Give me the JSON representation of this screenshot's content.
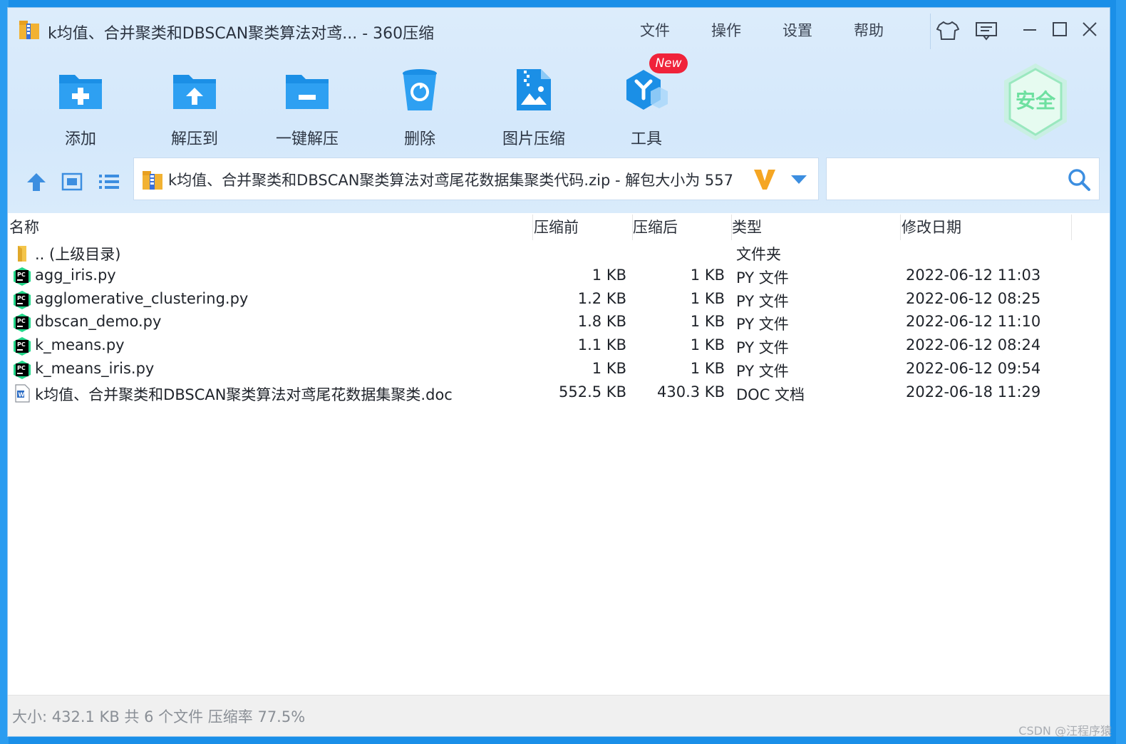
{
  "window": {
    "title": "k均值、合并聚类和DBSCAN聚类算法对鸢... - 360压缩"
  },
  "menu": [
    {
      "label": "文件"
    },
    {
      "label": "操作"
    },
    {
      "label": "设置"
    },
    {
      "label": "帮助"
    }
  ],
  "toolbar": {
    "tools": [
      {
        "label": "添加",
        "icon": "add-folder-icon"
      },
      {
        "label": "解压到",
        "icon": "extract-to-icon"
      },
      {
        "label": "一键解压",
        "icon": "one-click-extract-icon"
      },
      {
        "label": "删除",
        "icon": "recycle-bin-icon"
      },
      {
        "label": "图片压缩",
        "icon": "image-compress-icon"
      },
      {
        "label": "工具",
        "icon": "tools-icon"
      }
    ],
    "new_badge": "New",
    "security_label": "安全"
  },
  "address": {
    "path": "k均值、合并聚类和DBSCAN聚类算法对鸢尾花数据集聚类代码.zip - 解包大小为 557"
  },
  "columns": {
    "name": "名称",
    "size": "压缩前",
    "compressed": "压缩后",
    "type": "类型",
    "date": "修改日期"
  },
  "files": [
    {
      "name": ".. (上级目录)",
      "size": "",
      "compressed": "",
      "type": "文件夹",
      "date": "",
      "icon": "folder-icon"
    },
    {
      "name": "agg_iris.py",
      "size": "1 KB",
      "compressed": "1 KB",
      "type": "PY 文件",
      "date": "2022-06-12 11:03",
      "icon": "pycharm-file-icon"
    },
    {
      "name": "agglomerative_clustering.py",
      "size": "1.2 KB",
      "compressed": "1 KB",
      "type": "PY 文件",
      "date": "2022-06-12 08:25",
      "icon": "pycharm-file-icon"
    },
    {
      "name": "dbscan_demo.py",
      "size": "1.8 KB",
      "compressed": "1 KB",
      "type": "PY 文件",
      "date": "2022-06-12 11:10",
      "icon": "pycharm-file-icon"
    },
    {
      "name": "k_means.py",
      "size": "1.1 KB",
      "compressed": "1 KB",
      "type": "PY 文件",
      "date": "2022-06-12 08:24",
      "icon": "pycharm-file-icon"
    },
    {
      "name": "k_means_iris.py",
      "size": "1 KB",
      "compressed": "1 KB",
      "type": "PY 文件",
      "date": "2022-06-12 09:54",
      "icon": "pycharm-file-icon"
    },
    {
      "name": "k均值、合并聚类和DBSCAN聚类算法对鸢尾花数据集聚类.doc",
      "size": "552.5 KB",
      "compressed": "430.3 KB",
      "type": "DOC 文档",
      "date": "2022-06-18 11:29",
      "icon": "word-doc-icon"
    }
  ],
  "status": {
    "text": "大小: 432.1 KB 共 6 个文件 压缩率 77.5%"
  },
  "watermark": "CSDN @汪程序猿",
  "colors": {
    "accent": "#1e90e8",
    "header_bg": "#d8eafb",
    "badge": "#f0233a",
    "security": "#6ee0a0"
  }
}
